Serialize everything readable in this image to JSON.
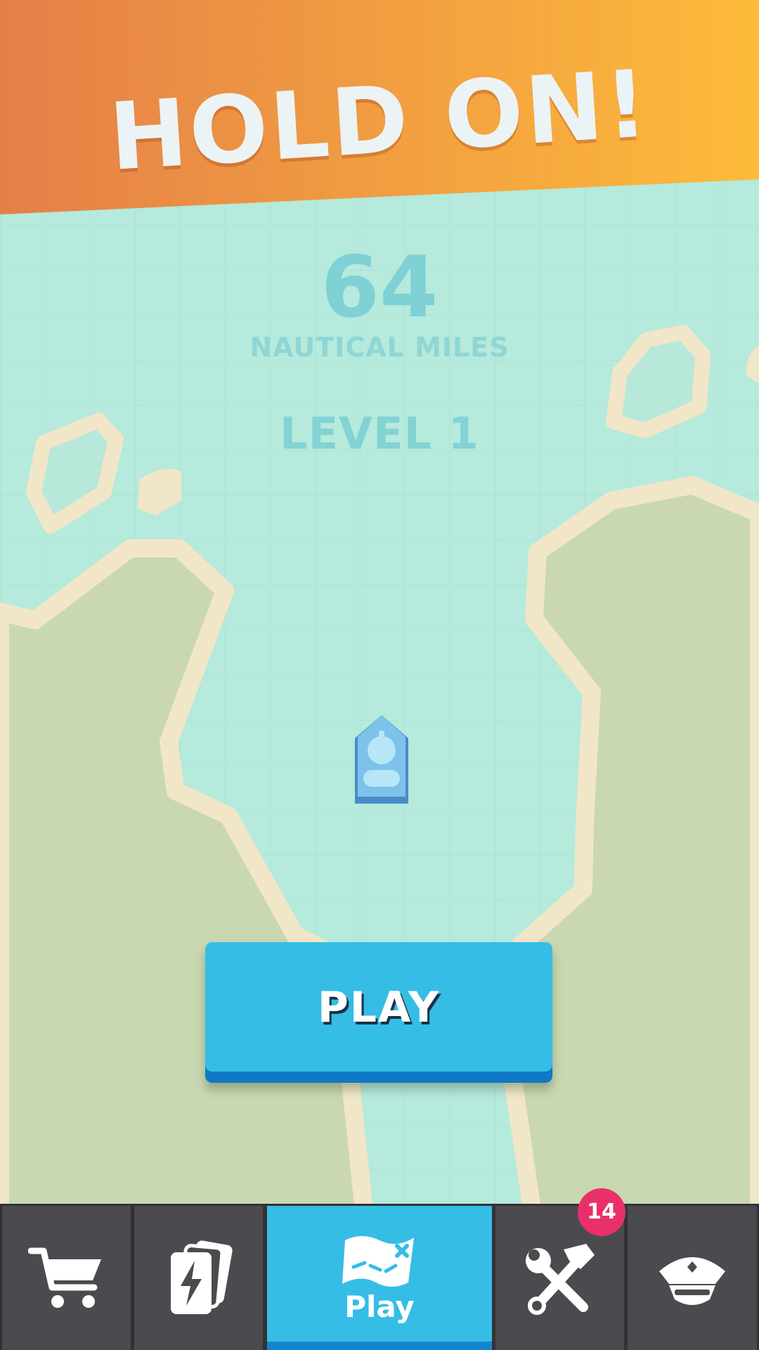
{
  "banner": {
    "title": "HOLD ON!"
  },
  "stats": {
    "distance_value": "64",
    "distance_unit": "NAUTICAL MILES",
    "level": "LEVEL 1"
  },
  "play_button": {
    "label": "PLAY"
  },
  "tabbar": {
    "tabs": [
      {
        "id": "shop",
        "icon": "shopping-cart-icon",
        "label": ""
      },
      {
        "id": "cards",
        "icon": "lightning-cards-icon",
        "label": ""
      },
      {
        "id": "play",
        "icon": "treasure-map-icon",
        "label": "Play",
        "active": true
      },
      {
        "id": "upgrades",
        "icon": "hammer-wrench-icon",
        "label": "",
        "badge": "14"
      },
      {
        "id": "captain",
        "icon": "captain-hat-icon",
        "label": ""
      }
    ]
  },
  "colors": {
    "banner_start": "#e57f48",
    "banner_end": "#fdbb3b",
    "water": "#b5eadc",
    "land": "#c9d8b0",
    "shore": "#f1e6c8",
    "play_button": "#35bde6",
    "tab_bar": "#4b4b4f",
    "badge": "#e9306a"
  }
}
